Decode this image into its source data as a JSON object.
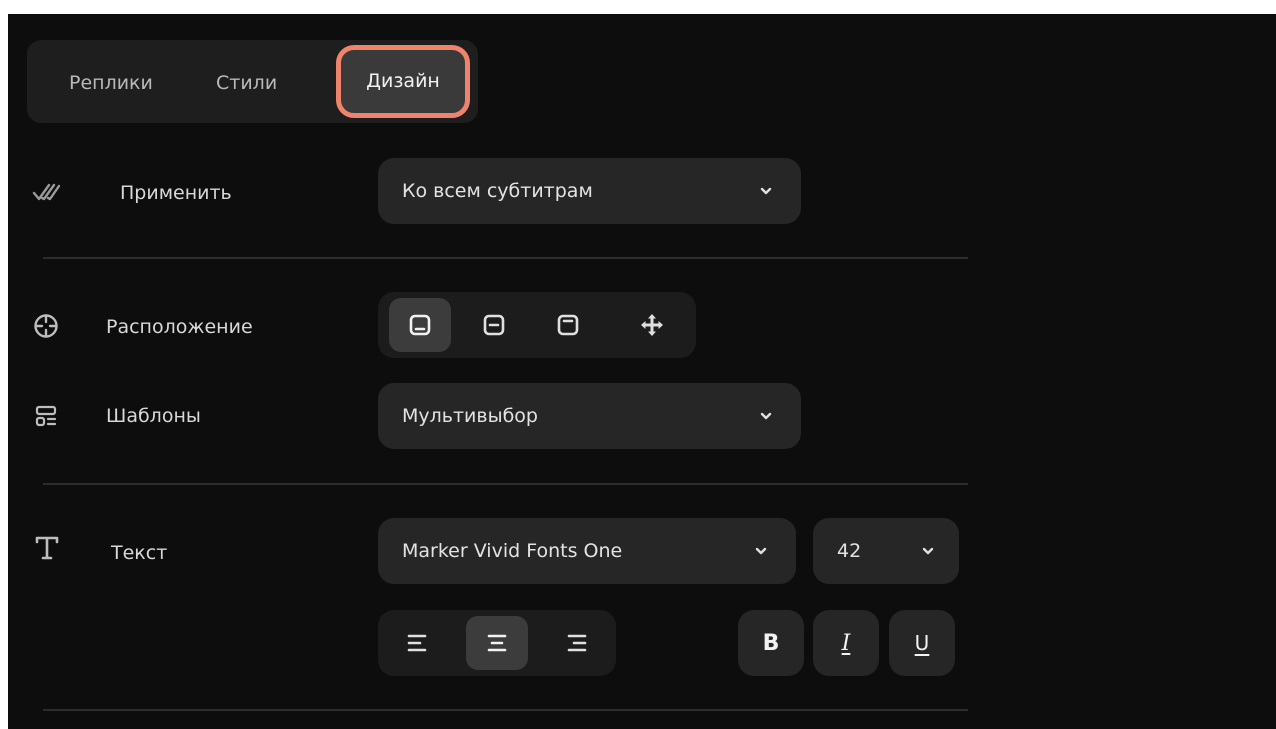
{
  "tabs": [
    {
      "label": "Реплики",
      "active": false
    },
    {
      "label": "Стили",
      "active": false
    },
    {
      "label": "Дизайн",
      "active": true
    }
  ],
  "apply": {
    "label": "Применить",
    "icon": "double-check-icon",
    "value": "Ко всем субтитрам"
  },
  "position": {
    "label": "Расположение",
    "icon": "crosshair-icon",
    "options": [
      "position-bottom-icon",
      "position-middle-icon",
      "position-top-icon",
      "move-icon"
    ],
    "selected_index": 0
  },
  "templates": {
    "label": "Шаблоны",
    "icon": "template-icon",
    "value": "Мультивыбор"
  },
  "text": {
    "label": "Текст",
    "icon": "text-t-icon",
    "font": "Marker Vivid Fonts One",
    "size": "42",
    "align_options": [
      "align-left-icon",
      "align-center-icon",
      "align-right-icon"
    ],
    "align_selected_index": 1,
    "bold_label": "B",
    "italic_label": "I",
    "underline_label": "U"
  },
  "colors": {
    "accent": "#f0836c",
    "background": "#0d0d0d",
    "control": "#262626"
  }
}
